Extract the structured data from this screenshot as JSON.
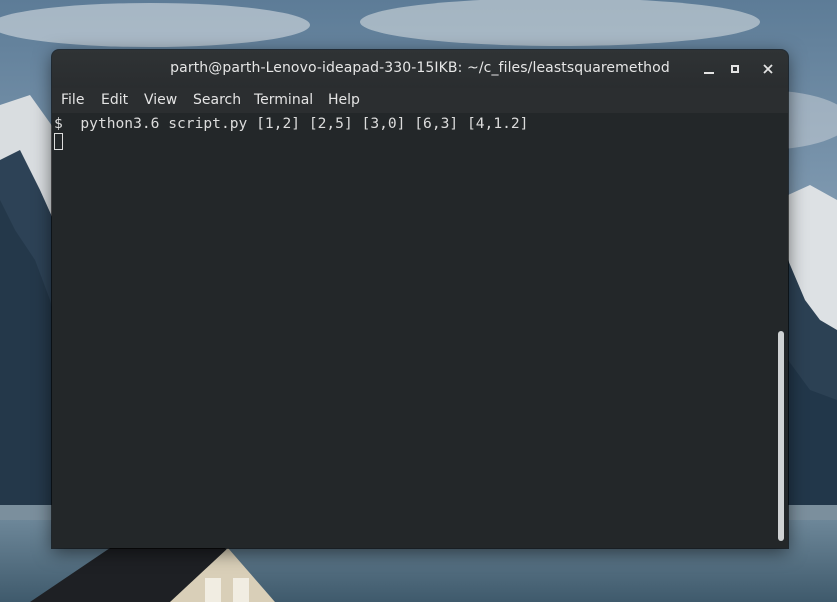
{
  "window": {
    "title": "parth@parth-Lenovo-ideapad-330-15IKB: ~/c_files/leastsquaremethod",
    "controls": {
      "minimize": "minimize-icon",
      "maximize": "maximize-icon",
      "close": "close-icon"
    }
  },
  "menu": {
    "file": "File",
    "edit": "Edit",
    "view": "View",
    "search": "Search",
    "terminal": "Terminal",
    "help": "Help"
  },
  "terminal": {
    "prompt_symbol": "$",
    "command": "python3.6 script.py [1,2] [2,5] [3,0] [6,3] [4,1.2]"
  },
  "colors": {
    "terminal_bg": "#232729",
    "titlebar_bg": "#2f3335",
    "text": "#dcdcdc"
  }
}
